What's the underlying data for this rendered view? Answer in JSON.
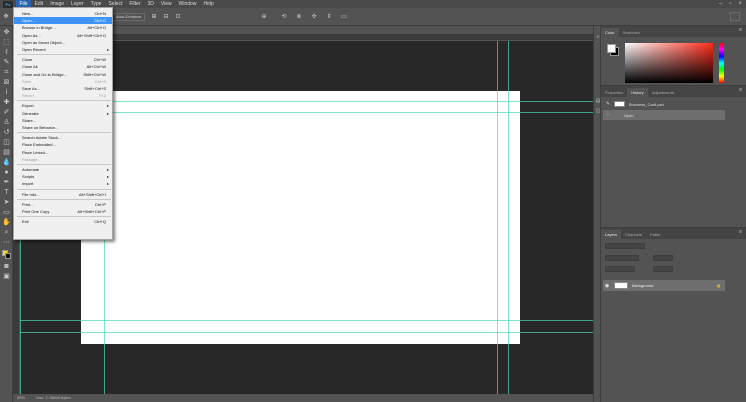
{
  "app": {
    "logo": "Ps"
  },
  "menubar": {
    "items": [
      "File",
      "Edit",
      "Image",
      "Layer",
      "Type",
      "Select",
      "Filter",
      "3D",
      "View",
      "Window",
      "Help"
    ],
    "window_controls": [
      "–",
      "▫",
      "×"
    ]
  },
  "optionsbar": {
    "button_label": "Auto-Enhance"
  },
  "status": {
    "zoom": "25%",
    "doc": "Doc: 2.78M/0 bytes"
  },
  "file_menu": {
    "groups": [
      [
        {
          "label": "New...",
          "shortcut": "Ctrl+N"
        },
        {
          "label": "Open...",
          "shortcut": "Ctrl+O",
          "highlighted": true
        },
        {
          "label": "Browse in Bridge...",
          "shortcut": "Alt+Ctrl+O"
        },
        {
          "label": "Open As...",
          "shortcut": "Alt+Shift+Ctrl+O"
        },
        {
          "label": "Open as Smart Object...",
          "shortcut": ""
        },
        {
          "label": "Open Recent",
          "shortcut": "",
          "submenu": true
        }
      ],
      [
        {
          "label": "Close",
          "shortcut": "Ctrl+W"
        },
        {
          "label": "Close All",
          "shortcut": "Alt+Ctrl+W"
        },
        {
          "label": "Close and Go to Bridge...",
          "shortcut": "Shift+Ctrl+W"
        },
        {
          "label": "Save",
          "shortcut": "Ctrl+S",
          "disabled": true
        },
        {
          "label": "Save As...",
          "shortcut": "Shift+Ctrl+S"
        },
        {
          "label": "Revert",
          "shortcut": "F12",
          "disabled": true
        }
      ],
      [
        {
          "label": "Export",
          "shortcut": "",
          "submenu": true
        },
        {
          "label": "Generate",
          "shortcut": "",
          "submenu": true
        },
        {
          "label": "Share...",
          "shortcut": ""
        },
        {
          "label": "Share on Behance...",
          "shortcut": ""
        }
      ],
      [
        {
          "label": "Search Adobe Stock...",
          "shortcut": ""
        },
        {
          "label": "Place Embedded...",
          "shortcut": ""
        },
        {
          "label": "Place Linked...",
          "shortcut": ""
        },
        {
          "label": "Package...",
          "shortcut": "",
          "disabled": true
        }
      ],
      [
        {
          "label": "Automate",
          "shortcut": "",
          "submenu": true
        },
        {
          "label": "Scripts",
          "shortcut": "",
          "submenu": true
        },
        {
          "label": "Import",
          "shortcut": "",
          "submenu": true
        }
      ],
      [
        {
          "label": "File Info...",
          "shortcut": "Alt+Shift+Ctrl+I"
        }
      ],
      [
        {
          "label": "Print...",
          "shortcut": "Ctrl+P"
        },
        {
          "label": "Print One Copy",
          "shortcut": "Alt+Shift+Ctrl+P"
        }
      ],
      [
        {
          "label": "Exit",
          "shortcut": "Ctrl+Q"
        }
      ]
    ]
  },
  "color_panel": {
    "tabs": [
      "Color",
      "Swatches"
    ],
    "active": 0,
    "foreground": "#ffffff",
    "background": "#000000",
    "hue": "#ff2a1a"
  },
  "history_panel": {
    "tabs": [
      "Properties",
      "History",
      "Adjustments"
    ],
    "active": 1,
    "snapshot": "Business_Card.psd",
    "states": [
      "Open"
    ]
  },
  "layers_panel": {
    "tabs": [
      "Layers",
      "Channels",
      "Paths"
    ],
    "active": 0,
    "layers": [
      {
        "name": "Background",
        "locked": true,
        "visible": true
      }
    ]
  },
  "colors": {
    "guide": "#4ad4b6",
    "canvas_bg": "#282828",
    "ui": "#535353",
    "highlight": "#3d94f6"
  }
}
